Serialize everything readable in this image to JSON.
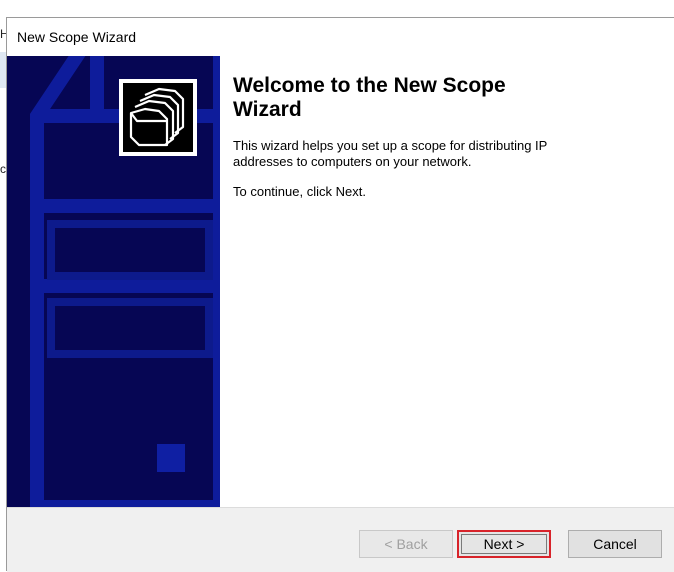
{
  "background": {
    "stub_chars": [
      "H",
      "c"
    ]
  },
  "dialog": {
    "title": "New Scope Wizard",
    "banner_icon": "folders-icon",
    "heading": "Welcome to the New Scope Wizard",
    "description": "This wizard helps you set up a scope for distributing IP addresses to computers on your network.",
    "instruction": "To continue, click Next.",
    "buttons": {
      "back": "< Back",
      "next": "Next >",
      "cancel": "Cancel"
    },
    "highlight_color": "#d8232a",
    "banner_color": "#060654"
  }
}
